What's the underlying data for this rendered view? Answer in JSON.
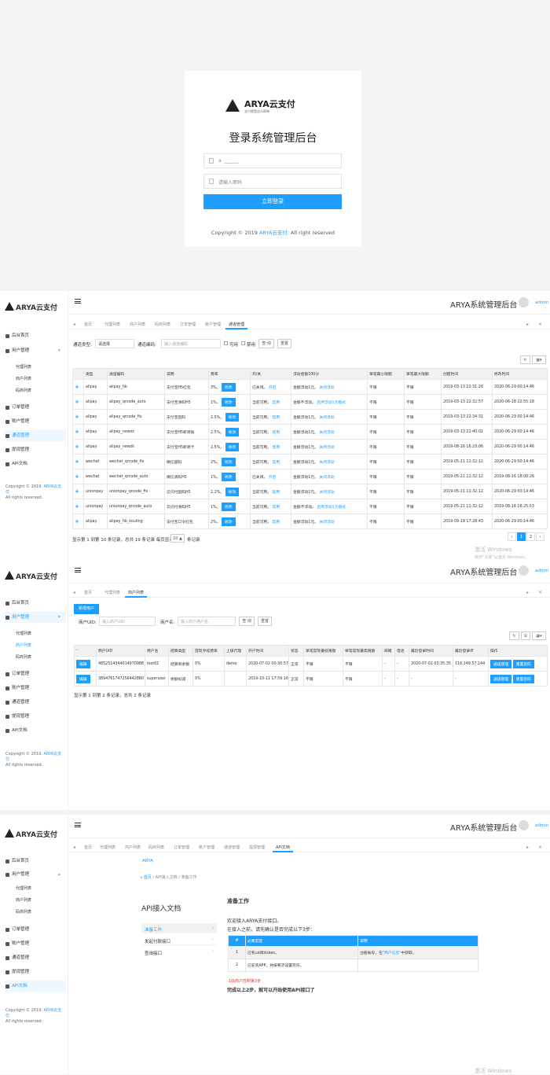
{
  "login": {
    "logo_text": "ARYA云支付",
    "logo_sub": "支付就是这么简单",
    "title": "登录系统管理后台",
    "username_value": "a  ______",
    "password_placeholder": "请输入密码",
    "submit_label": "立即登录",
    "copyright_prefix": "Copyright © 2019 ",
    "copyright_brand": "ARYA云支付",
    "copyright_suffix": ". All right reserved"
  },
  "common": {
    "logo_text": "ARYA云支付",
    "app_title": "ARYA系统管理后台",
    "user_name": "admin",
    "copyright_line1": "Copyright © 2019. ",
    "copyright_brand": "ARYA云支付",
    "copyright_line2": "All rights reserved.",
    "watermark1": "激活 Windows",
    "watermark2": "转到\"设置\"以激活 Windows。"
  },
  "nav": [
    {
      "label": "后台首页",
      "icon": "home-icon"
    },
    {
      "label": "用户管理",
      "icon": "user-icon"
    },
    {
      "label": "代理列表",
      "icon": "user-icon"
    },
    {
      "label": "商户列表",
      "icon": "user-icon"
    },
    {
      "label": "码商列表",
      "icon": "user-icon"
    },
    {
      "label": "订单管理",
      "icon": "order-icon"
    },
    {
      "label": "账户管理",
      "icon": "account-icon"
    },
    {
      "label": "通道管理",
      "icon": "channel-icon"
    },
    {
      "label": "提现管理",
      "icon": "withdraw-icon"
    },
    {
      "label": "API文档",
      "icon": "doc-icon"
    }
  ],
  "tabs_full": [
    "首页",
    "代理列表",
    "商户列表",
    "码商列表",
    "订单管理",
    "账户管理",
    "通道管理",
    "提现管理",
    "API文档"
  ],
  "channel": {
    "tabs": [
      "首页",
      "代理列表",
      "商户列表",
      "码商列表",
      "订单管理",
      "账户管理",
      "通道管理"
    ],
    "filter_type_label": "通道类型:",
    "filter_type_value": "请选择",
    "filter_code_label": "通道编码:",
    "filter_code_placeholder": "输入通道编码",
    "opt_enable": "可用",
    "opt_disable": "禁用",
    "search_label": "查 询",
    "reset_label": "重置",
    "columns": [
      "类型",
      "通道编码",
      "说明",
      "费率",
      "开/关",
      "浮动金额100分",
      "单笔最小限额",
      "单笔最大限额",
      "创建时间",
      "修改时间"
    ],
    "edit_label": "修改",
    "rows": [
      {
        "type": "alipay",
        "code": "alipay_hb",
        "desc": "支付宝H5红包",
        "rate": "3%。",
        "status": "已关闭。",
        "action": "开启",
        "float": "金额浮动1元。",
        "float_action": "关闭浮动",
        "min": "不限",
        "max": "不限",
        "created": "2019-03-13 22:31:26",
        "updated": "2020-06-29 00:14:46"
      },
      {
        "type": "alipay",
        "code": "alipay_qrcode_auto",
        "desc": "支付宝清码H5",
        "rate": "1%。",
        "status": "当前可用。",
        "action": "禁用",
        "float": "金额不浮动。",
        "float_action": "启用浮动1元模式",
        "min": "不限",
        "max": "不限",
        "created": "2019-03-13 22:32:57",
        "updated": "2020-06-18 22:55:18"
      },
      {
        "type": "alipay",
        "code": "alipay_qrcode_fix",
        "desc": "支付宝固码",
        "rate": "2.5%。",
        "status": "当前可用。",
        "action": "禁用",
        "float": "金额浮动1元。",
        "float_action": "关闭浮动",
        "min": "不限",
        "max": "不限",
        "created": "2019-03-13 22:34:31",
        "updated": "2020-06-29 00:14:46"
      },
      {
        "type": "alipay",
        "code": "alipay_newzz",
        "desc": "支付宝H5新转账",
        "rate": "2.5%。",
        "status": "当前可用。",
        "action": "禁用",
        "float": "金额浮动1元。",
        "float_action": "关闭浮动",
        "min": "不限",
        "max": "不限",
        "created": "2019-03-13 22:40:02",
        "updated": "2020-06-29 00:14:46"
      },
      {
        "type": "alipay",
        "code": "alipay_newzk",
        "desc": "支付宝H5新转卡",
        "rate": "2.5%。",
        "status": "当前可用。",
        "action": "禁用",
        "float": "金额浮动1元。",
        "float_action": "关闭浮动",
        "min": "不限",
        "max": "不限",
        "created": "2019-08-16 16:23:06",
        "updated": "2020-06-29 00:14:46"
      },
      {
        "type": "wechat",
        "code": "wechat_qrcode_fix",
        "desc": "微信固码",
        "rate": "2%。",
        "status": "当前可用。",
        "action": "禁用",
        "float": "金额浮动1元。",
        "float_action": "关闭浮动",
        "min": "不限",
        "max": "不限",
        "created": "2019-05-21 11:32:12",
        "updated": "2020-06-29 00:14:46"
      },
      {
        "type": "wechat",
        "code": "wechat_qrcode_auto",
        "desc": "微信清码H5",
        "rate": "1%。",
        "status": "已关闭。",
        "action": "开启",
        "float": "金额浮动1元。",
        "float_action": "关闭浮动",
        "min": "不限",
        "max": "不限",
        "created": "2019-05-21 11:32:12",
        "updated": "2019-08-16 18:00:26"
      },
      {
        "type": "unionpay",
        "code": "unionpay_qrcode_fix",
        "desc": "云闪付固码H5",
        "rate": "2.2%。",
        "status": "当前可用。",
        "action": "禁用",
        "float": "金额浮动1元。",
        "float_action": "关闭浮动",
        "min": "不限",
        "max": "不限",
        "created": "2019-05-21 11:32:12",
        "updated": "2020-06-29 00:14:46"
      },
      {
        "type": "unionpay",
        "code": "unionpay_qrcode_auto",
        "desc": "云闪付清码H5",
        "rate": "1%。",
        "status": "当前可用。",
        "action": "禁用",
        "float": "金额不浮动。",
        "float_action": "启用浮动1元模式",
        "min": "不限",
        "max": "不限",
        "created": "2019-05-21 11:32:12",
        "updated": "2019-08-16 16:25:53"
      },
      {
        "type": "alipay",
        "code": "alipay_hb_kouling",
        "desc": "支付宝口令红包",
        "rate": "2%。",
        "status": "当前可用。",
        "action": "禁用",
        "float": "金额浮动1元。",
        "float_action": "关闭浮动",
        "min": "不限",
        "max": "不限",
        "created": "2019-09-19 17:28:43",
        "updated": "2020-06-29 00:14:46"
      }
    ],
    "pager_text_a": "显示第 1 到第 10 条记录，总共 19 条记录 每页显示",
    "pager_size": "10 ▲",
    "pager_text_b": "条记录",
    "pages": [
      "‹",
      "1",
      "2",
      "›"
    ]
  },
  "merchant": {
    "tabs": [
      "首页",
      "代理列表",
      "商户列表"
    ],
    "add_label": "新增用户",
    "uid_label": "商户UID:",
    "uid_placeholder": "输入商户UID",
    "name_label": "商户名:",
    "name_placeholder": "输入商户用户名",
    "search_label": "查 询",
    "reset_label": "重置",
    "columns": [
      "-",
      "商户UID",
      "用户名",
      "结算类型",
      "提现手续费率",
      "上级代理",
      "开户时间",
      "状态",
      "单笔提现最低限额",
      "单笔提现最高限额",
      "邮箱",
      "电话",
      "最近登录时间",
      "最近登录IP",
      "操作"
    ],
    "edit_label": "编辑",
    "op1": "通道管理",
    "op2": "重置密码",
    "rows": [
      {
        "uid": "4852514344014970988",
        "name": "test01",
        "settle": "结算到余额",
        "fee": "0%",
        "agent": "demo",
        "open": "2020-07-02 00:30:57",
        "state": "正常",
        "min": "不限",
        "max": "不限",
        "email": "-",
        "phone": "-",
        "last_time": "2020-07-02 03:35:35",
        "last_ip": "116.249.57.144"
      },
      {
        "uid": "3894761747256442880",
        "name": "superuser",
        "settle": "余额扣减",
        "fee": "0%",
        "agent": "",
        "open": "2019-10-11 17:59:16",
        "state": "正常",
        "min": "不限",
        "max": "不限",
        "email": "-",
        "phone": "-",
        "last_time": "-",
        "last_ip": "-"
      }
    ],
    "pager_text": "显示第 1 到第 2 条记录，总共 2 条记录"
  },
  "api": {
    "logo_alt": "ARYA",
    "breadcrumb": [
      "首页",
      "API接入文档",
      "准备工作"
    ],
    "doc_title": "API接入文档",
    "menu": [
      "准备工作",
      "发起付款接口",
      "查询接口"
    ],
    "section_title": "准备工作",
    "welcome": "欢迎接入ARYA支付接口。",
    "before": "在接入之前，请先确认是否完成以下3步：",
    "table_head": [
      "#",
      "必要前提",
      "说明"
    ],
    "table_rows": [
      {
        "n": "1",
        "req": "已有uid和token。",
        "note_a": "注册账号，在",
        "note_link": "\"商户信息\"",
        "note_b": "中获取。"
      },
      {
        "n": "2",
        "req": "已安装APP，并按要求设置完毕。",
        "note_a": "",
        "note_link": "",
        "note_b": ""
      }
    ],
    "hint": "-1由商户控制第3步",
    "done": "完成以上2步，就可以开始使用API接口了"
  },
  "colors": {
    "accent": "#1e9fff",
    "ok": "#5fb878"
  }
}
